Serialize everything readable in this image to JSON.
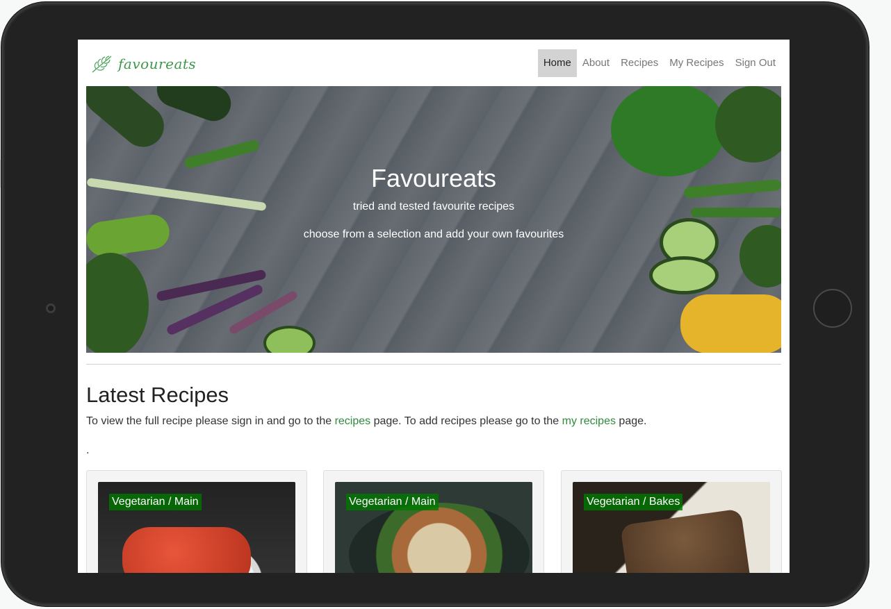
{
  "brand": {
    "name": "favoureats"
  },
  "nav": {
    "items": [
      {
        "label": "Home",
        "active": true
      },
      {
        "label": "About",
        "active": false
      },
      {
        "label": "Recipes",
        "active": false
      },
      {
        "label": "My Recipes",
        "active": false
      },
      {
        "label": "Sign Out",
        "active": false
      }
    ]
  },
  "hero": {
    "title": "Favoureats",
    "subtitle": "tried and tested favourite recipes",
    "tagline": "choose from a selection and add your own favourites"
  },
  "latest": {
    "heading": "Latest Recipes",
    "intro_before": "To view the full recipe please sign in and go to the ",
    "intro_link1": "recipes",
    "intro_middle": " page. To add recipes please go to the ",
    "intro_link2": "my recipes",
    "intro_after": " page.",
    "dot": "."
  },
  "cards": [
    {
      "category": "Vegetarian / Main"
    },
    {
      "category": "Vegetarian / Main"
    },
    {
      "category": "Vegetarian / Bakes"
    }
  ],
  "colors": {
    "accent": "#2e8b3a",
    "badge": "#007800",
    "frame": "#222222"
  }
}
